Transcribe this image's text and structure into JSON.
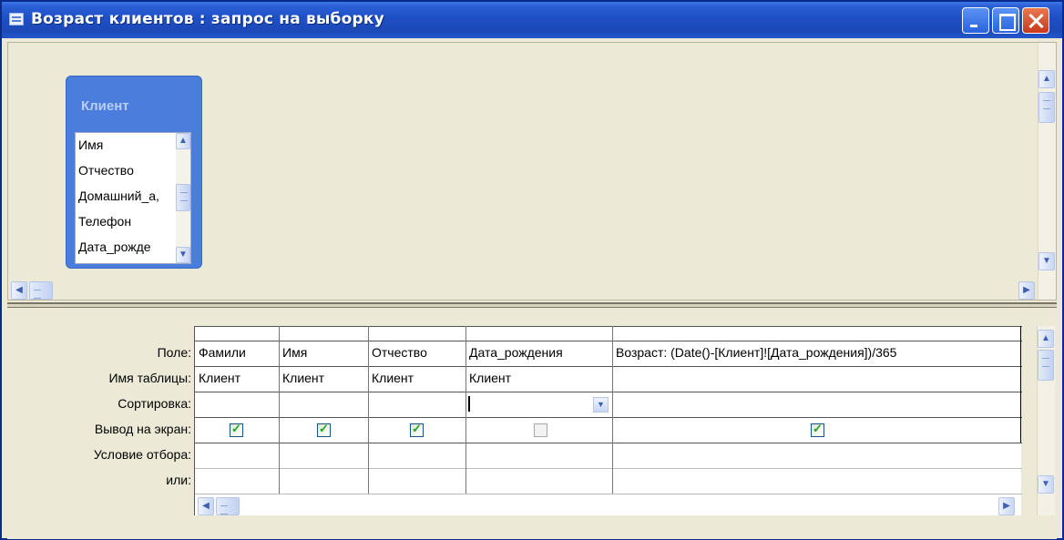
{
  "window": {
    "title": "Возраст клиентов : запрос на выборку"
  },
  "table_box": {
    "title": "Клиент",
    "fields": [
      "Имя",
      "Отчество",
      "Домашний_а,",
      "Телефон",
      "Дата_рожде"
    ]
  },
  "grid": {
    "row_labels": [
      "Поле:",
      "Имя таблицы:",
      "Сортировка:",
      "Вывод на экран:",
      "Условие отбора:",
      "или:"
    ],
    "columns": [
      {
        "field": "Фамили",
        "table": "Клиент",
        "sort": "",
        "show": true
      },
      {
        "field": "Имя",
        "table": "Клиент",
        "sort": "",
        "show": true
      },
      {
        "field": "Отчество",
        "table": "Клиент",
        "sort": "",
        "show": true
      },
      {
        "field": "Дата_рождения",
        "table": "Клиент",
        "sort": "",
        "show": false
      },
      {
        "field": "Возраст: (Date()-[Клиент]![Дата_рождения])/365",
        "table": "",
        "sort": "",
        "show": true
      }
    ]
  },
  "icons": {
    "app": "query-icon",
    "scroll_up": "arrow-up-icon",
    "scroll_down": "arrow-down-icon",
    "scroll_left": "arrow-left-icon",
    "scroll_right": "arrow-right-icon",
    "dropdown": "chevron-down-icon"
  },
  "colors": {
    "titlebar": "#1e4fc4",
    "table_header": "#4b7ddc",
    "check": "#21a121"
  }
}
